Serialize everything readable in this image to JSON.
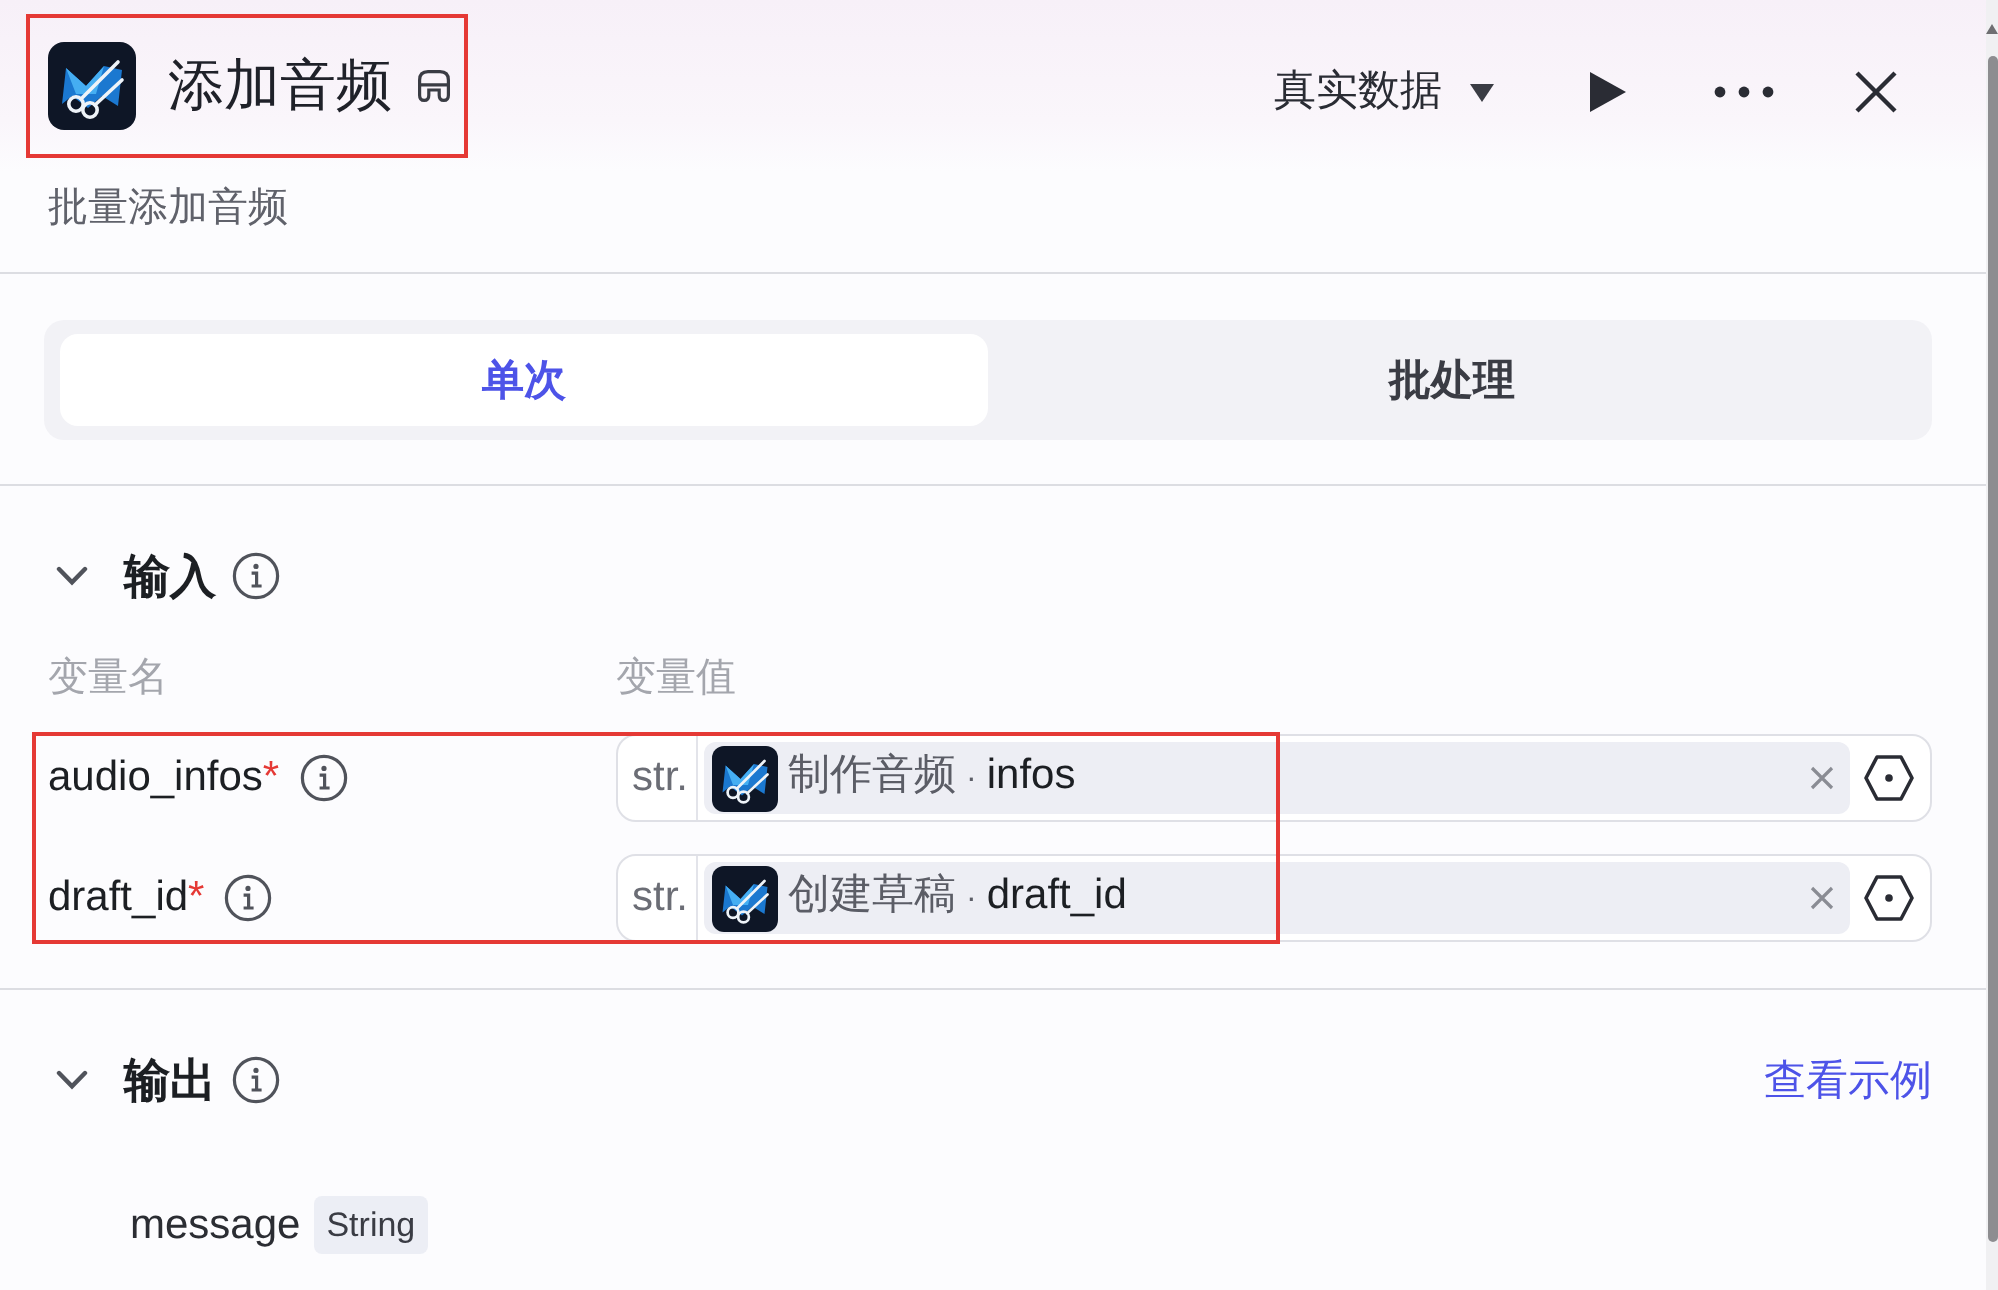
{
  "header": {
    "title": "添加音频",
    "highlighted": true,
    "description": "批量添加音频"
  },
  "toolbar": {
    "data_source": "真实数据"
  },
  "tabs": [
    {
      "label": "单次",
      "selected": true
    },
    {
      "label": "批处理",
      "selected": false
    }
  ],
  "input": {
    "title": "输入",
    "expanded": true,
    "highlighted": true,
    "columns": [
      "变量名",
      "变量值"
    ],
    "variables": [
      {
        "name": "audio_infos",
        "required_mark": "*",
        "type": "str.",
        "source_node": "制作音频",
        "separator": "·",
        "source_field": "infos"
      },
      {
        "name": "draft_id",
        "required_mark": "*",
        "type": "str.",
        "source_node": "创建草稿",
        "separator": "·",
        "source_field": "draft_id"
      }
    ]
  },
  "output": {
    "title": "输出",
    "expanded": true,
    "link": "查看示例",
    "fields": [
      {
        "name": "message",
        "type": "String"
      }
    ]
  }
}
